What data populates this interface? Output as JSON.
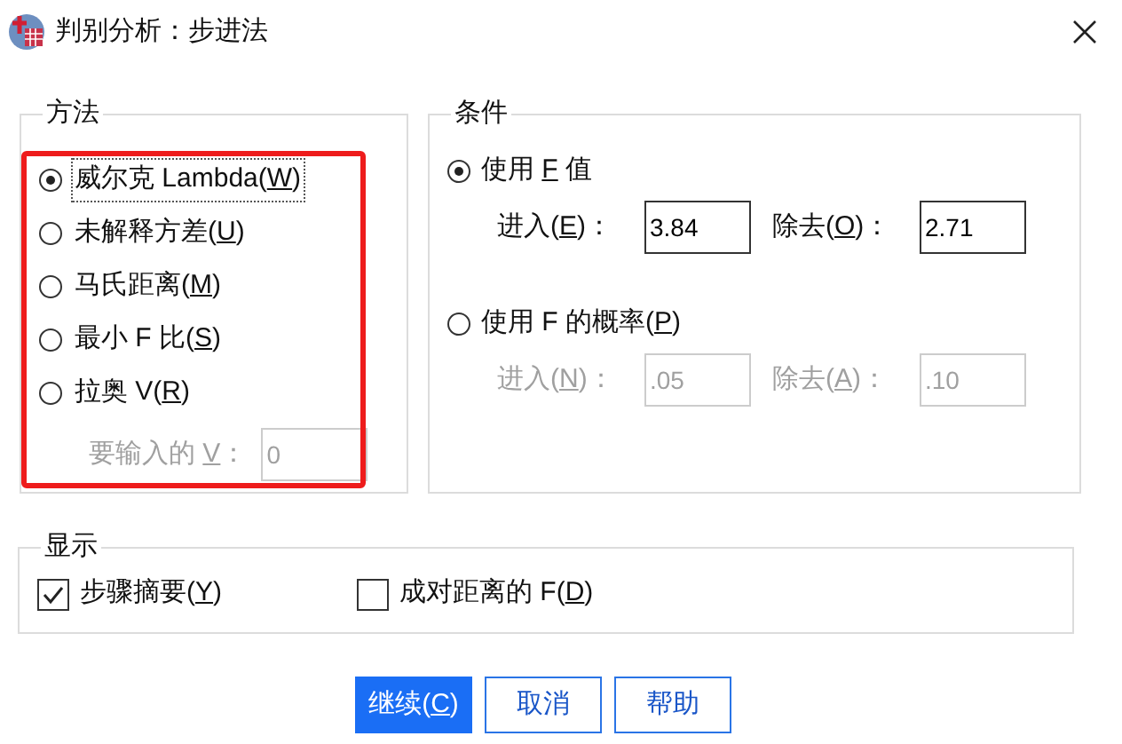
{
  "window": {
    "title": "判别分析：步进法"
  },
  "method": {
    "title": "方法",
    "options": [
      {
        "label": {
          "t": "威尔克 Lambda(",
          "k": "W",
          "a": ")"
        },
        "selected": true
      },
      {
        "label": {
          "t": "未解释方差(",
          "k": "U",
          "a": ")"
        },
        "selected": false
      },
      {
        "label": {
          "t": "马氏距离(",
          "k": "M",
          "a": ")"
        },
        "selected": false
      },
      {
        "label": {
          "t": "最小 F 比(",
          "k": "S",
          "a": ")"
        },
        "selected": false
      },
      {
        "label": {
          "t": "拉奥 V(",
          "k": "R",
          "a": ")"
        },
        "selected": false
      }
    ],
    "v_field": {
      "label": {
        "t": "要输入的 ",
        "k": "V",
        "a": "："
      },
      "value": "0",
      "disabled": true
    }
  },
  "criteria": {
    "title": "条件",
    "options": [
      {
        "label": {
          "t": "使用 ",
          "k": "F",
          "a": " 值"
        },
        "selected": true,
        "fields": [
          {
            "label": {
              "t": "进入(",
              "k": "E",
              "a": ")："
            },
            "value": "3.84",
            "disabled": false
          },
          {
            "label": {
              "t": "除去(",
              "k": "O",
              "a": ")："
            },
            "value": "2.71",
            "disabled": false
          }
        ]
      },
      {
        "label": {
          "t": "使用 F 的概率(",
          "k": "P",
          "a": ")"
        },
        "selected": false,
        "fields": [
          {
            "label": {
              "t": "进入(",
              "k": "N",
              "a": ")："
            },
            "value": ".05",
            "disabled": true
          },
          {
            "label": {
              "t": "除去(",
              "k": "A",
              "a": ")："
            },
            "value": ".10",
            "disabled": true
          }
        ]
      }
    ]
  },
  "display": {
    "title": "显示",
    "checkboxes": [
      {
        "label": {
          "t": "步骤摘要(",
          "k": "Y",
          "a": ")"
        },
        "checked": true
      },
      {
        "label": {
          "t": "成对距离的 F(",
          "k": "D",
          "a": ")"
        },
        "checked": false
      }
    ]
  },
  "buttons": [
    {
      "label": {
        "t": "继续(",
        "k": "C",
        "a": ")"
      },
      "primary": true
    },
    {
      "label": {
        "t": "取消"
      },
      "primary": false
    },
    {
      "label": {
        "t": "帮助"
      },
      "primary": false
    }
  ]
}
